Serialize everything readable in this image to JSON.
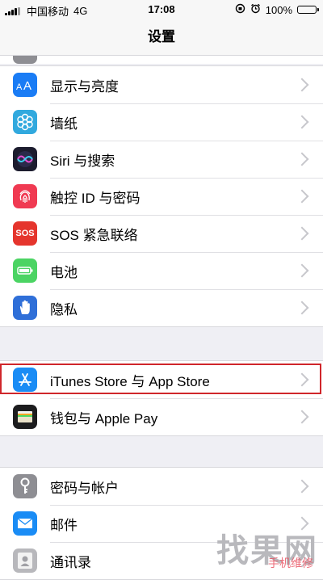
{
  "status_bar": {
    "carrier": "中国移动",
    "network": "4G",
    "time": "17:08",
    "battery": "100%"
  },
  "navbar": {
    "title": "设置"
  },
  "groups": [
    {
      "items": [
        {
          "label": "显示与亮度",
          "icon": "display-brightness-icon",
          "color": "#1a7cf5"
        },
        {
          "label": "墙纸",
          "icon": "wallpaper-icon",
          "color": "#31a9de"
        },
        {
          "label": "Siri 与搜索",
          "icon": "siri-icon",
          "color": "#1c1c2e"
        },
        {
          "label": "触控 ID 与密码",
          "icon": "fingerprint-icon",
          "color": "#f03a52"
        },
        {
          "label": "SOS 紧急联络",
          "icon": "sos-icon",
          "color": "#e5352d"
        },
        {
          "label": "电池",
          "icon": "battery-icon",
          "color": "#4bd463"
        },
        {
          "label": "隐私",
          "icon": "hand-icon",
          "color": "#2f6fd8"
        }
      ]
    },
    {
      "items": [
        {
          "label": "iTunes Store 与 App Store",
          "icon": "app-store-icon",
          "color": "#1a8cf5"
        },
        {
          "label": "钱包与 Apple Pay",
          "icon": "wallet-icon",
          "color": "#1c1c1e"
        }
      ]
    },
    {
      "items": [
        {
          "label": "密码与帐户",
          "icon": "key-icon",
          "color": "#8e8e93"
        },
        {
          "label": "邮件",
          "icon": "mail-icon",
          "color": "#1a8cf5"
        },
        {
          "label": "通讯录",
          "icon": "contacts-icon",
          "color": "#b8b8bc"
        }
      ]
    }
  ],
  "sos_text": "SOS",
  "watermark": {
    "main": "找果网",
    "sub": "手机维修"
  },
  "highlight_color": "#d0262b"
}
